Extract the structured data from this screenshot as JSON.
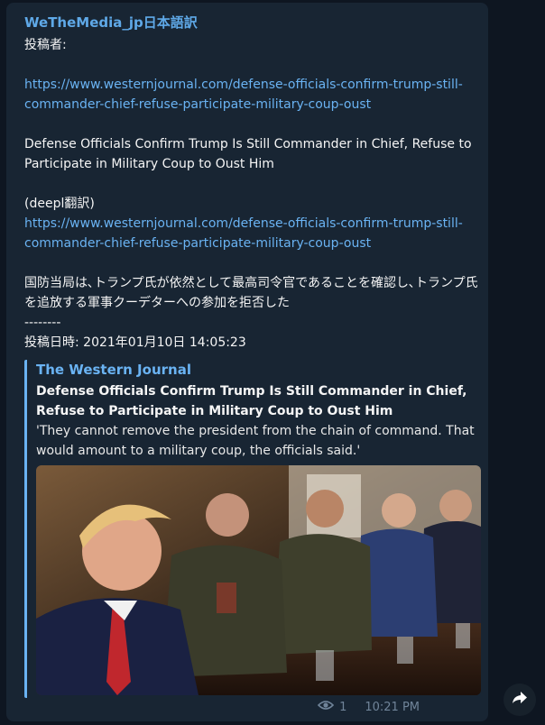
{
  "message": {
    "sender": "WeTheMedia_jp日本語訳",
    "posted_by_label": "投稿者:",
    "url_1": "https://www.westernjournal.com/defense-officials-confirm-trump-still-commander-chief-refuse-participate-military-coup-oust",
    "headline_en": "Defense Officials Confirm Trump Is Still Commander in Chief, Refuse to Participate in Military Coup to Oust Him",
    "translation_label": "(deepl翻訳)",
    "url_2": "https://www.westernjournal.com/defense-officials-confirm-trump-still-commander-chief-refuse-participate-military-coup-oust",
    "headline_ja": "国防当局は､トランプ氏が依然として最高司令官であることを確認し､トランプ氏を追放する軍事クーデターへの参加を拒否した",
    "separator": "--------",
    "posted_at": "投稿日時: 2021年01月10日 14:05:23"
  },
  "link_preview": {
    "site_name": "The Western Journal",
    "title": "Defense Officials Confirm Trump Is Still Commander in Chief, Refuse to Participate in Military Coup to Oust Him",
    "description": "'They cannot remove the president from the chain of command. That would amount to a military coup, the officials said.'"
  },
  "footer": {
    "views": "1",
    "time": "10:21 PM",
    "views_icon": "eye-icon",
    "share_icon": "share-arrow-icon"
  },
  "colors": {
    "background": "#0e1621",
    "bubble": "#182533",
    "link": "#6ab3f3",
    "sender": "#5fa9e8"
  }
}
